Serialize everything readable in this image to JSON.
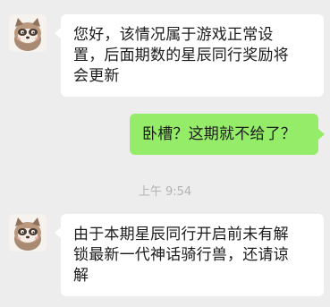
{
  "messages": [
    {
      "side": "incoming",
      "avatar_icon": "raccoon-avatar-icon",
      "lines": [
        "您好，该情况属于游戏正常设",
        "置，后面期数的星辰同行奖励将",
        "会更新"
      ]
    },
    {
      "side": "outgoing",
      "lines": [
        "卧槽？这期就不给了？"
      ]
    },
    {
      "side": "incoming",
      "avatar_icon": "raccoon-avatar-icon",
      "lines": [
        "由于本期星辰同行开启前未有解",
        "锁最新一代神话骑行兽，还请谅",
        "解"
      ]
    }
  ],
  "timestamp": "上午 9:54",
  "colors": {
    "background": "#ededed",
    "incoming_bubble": "#ffffff",
    "outgoing_bubble": "#95ec69",
    "text": "#1b1b1b",
    "timestamp": "#b3b3b3"
  }
}
